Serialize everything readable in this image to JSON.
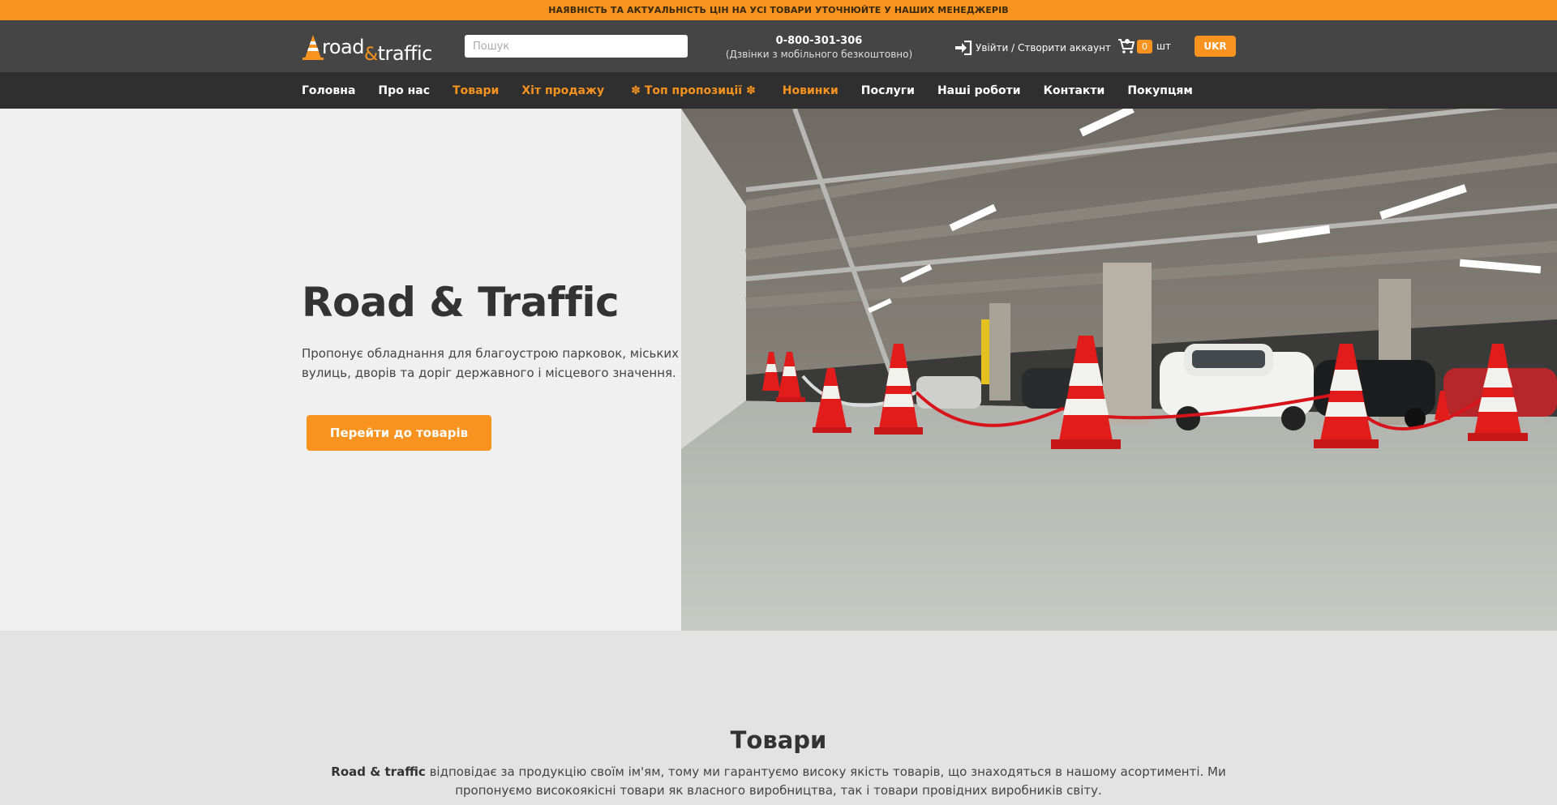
{
  "announcement": "НАЯВНІСТЬ ТА АКТУАЛЬНІСТЬ ЦІН НА УСІ ТОВАРИ УТОЧНЮЙТЕ У НАШИХ МЕНЕДЖЕРІВ",
  "header": {
    "logo": {
      "part1": "road",
      "amp": "&",
      "part2": "traffic"
    },
    "search_placeholder": "Пошук",
    "phone": "0-800-301-306",
    "phone_note": "(Дзвінки з мобільного безкоштовно)",
    "login_label": "Увійти / Створити аккаунт",
    "cart_count": "0",
    "cart_unit": "шт",
    "language": "UKR"
  },
  "nav": {
    "items": [
      {
        "label": "Головна"
      },
      {
        "label": "Про нас"
      },
      {
        "label": "Товари"
      },
      {
        "label": "Хіт продажу"
      },
      {
        "label": "Топ пропозиції"
      },
      {
        "label": "Новинки"
      },
      {
        "label": "Послуги"
      },
      {
        "label": "Наші роботи"
      },
      {
        "label": "Контакти"
      },
      {
        "label": "Покупцям"
      }
    ]
  },
  "hero": {
    "title": "Road & Traffic",
    "description": "Пропонує обладнання для благоустрою парковок, міських вулиць, дворів та доріг державного і місцевого значення.",
    "button": "Перейти до товарів"
  },
  "products": {
    "title": "Товари",
    "brand": "Road & traffic",
    "text": " відповідає за продукцію своїм ім'ям, тому ми гарантуємо високу якість товарів, що знаходяться в нашому асортименті. Ми пропонуємо високоякісні товари як власного виробництва, так і товари провідних виробників світу."
  },
  "colors": {
    "accent": "#f7931e",
    "header_bg": "#454545",
    "nav_bg": "#2f2f2f"
  },
  "icons": {
    "login": "login-arrow-icon",
    "cart": "cart-icon",
    "flower": "flower-icon"
  }
}
